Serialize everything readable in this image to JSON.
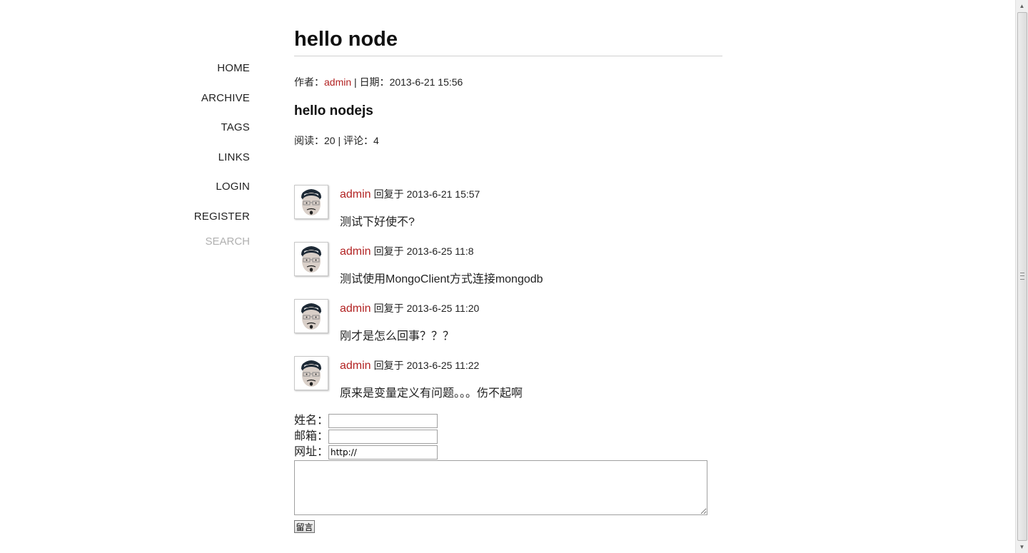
{
  "nav": {
    "items": [
      {
        "label": "HOME"
      },
      {
        "label": "ARCHIVE"
      },
      {
        "label": "TAGS"
      },
      {
        "label": "LINKS"
      },
      {
        "label": "LOGIN"
      },
      {
        "label": "REGISTER"
      }
    ],
    "search_label": "SEARCH"
  },
  "post": {
    "title": "hello node",
    "author_label": "作者：",
    "author": "admin",
    "separator": " | ",
    "date_label": "日期：",
    "date": "2013-6-21 15:56",
    "body": "hello nodejs",
    "read_label": "阅读：",
    "read_count": "20",
    "comment_label": "评论：",
    "comment_count": "4"
  },
  "comments": [
    {
      "author": "admin",
      "reply_text": "回复于",
      "time": "2013-6-21 15:57",
      "content": "测试下好使不?"
    },
    {
      "author": "admin",
      "reply_text": "回复于",
      "time": "2013-6-25 11:8",
      "content": "测试使用MongoClient方式连接mongodb"
    },
    {
      "author": "admin",
      "reply_text": "回复于",
      "time": "2013-6-25 11:20",
      "content": "刚才是怎么回事？？？"
    },
    {
      "author": "admin",
      "reply_text": "回复于",
      "time": "2013-6-25 11:22",
      "content": "原来是变量定义有问题。。。伤不起啊"
    }
  ],
  "form": {
    "name_label": "姓名：",
    "name_value": "",
    "email_label": "邮箱：",
    "email_value": "",
    "website_label": "网址：",
    "website_value": "http://",
    "message_value": "",
    "submit_label": "留言"
  },
  "colors": {
    "link": "#b22222",
    "search": "#b0b0b0"
  }
}
